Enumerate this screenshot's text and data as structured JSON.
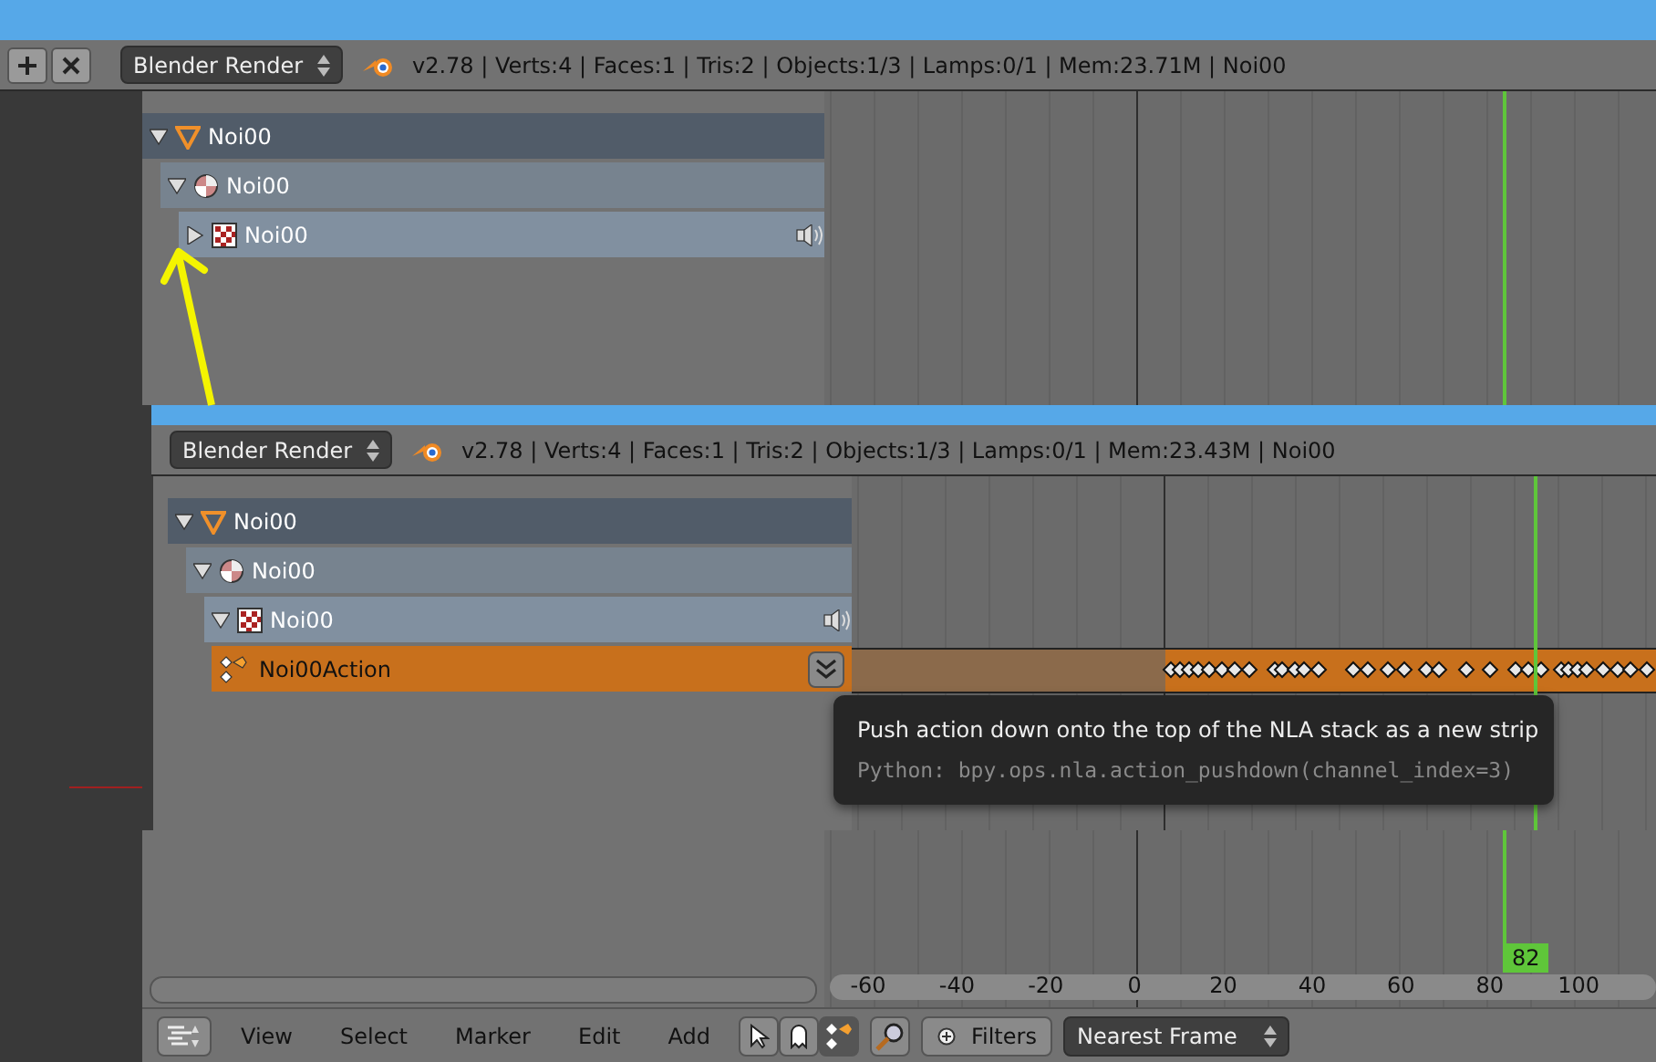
{
  "top_header": {
    "render_engine": "Blender Render",
    "stats": "v2.78 | Verts:4 | Faces:1 | Tris:2 | Objects:1/3 | Lamps:0/1 | Mem:23.71M | Noi00"
  },
  "top_channels": [
    {
      "name": "Noi00",
      "kind": "object",
      "expanded": true,
      "children": [
        {
          "name": "Noi00",
          "kind": "material",
          "expanded": true,
          "children": [
            {
              "name": "Noi00",
              "kind": "texture",
              "expanded": false
            }
          ]
        }
      ]
    }
  ],
  "bottom_header": {
    "render_engine": "Blender Render",
    "stats": "v2.78 | Verts:4 | Faces:1 | Tris:2 | Objects:1/3 | Lamps:0/1 | Mem:23.43M | Noi00"
  },
  "bottom_channels": [
    {
      "name": "Noi00",
      "kind": "object",
      "expanded": true,
      "children": [
        {
          "name": "Noi00",
          "kind": "material",
          "expanded": true,
          "children": [
            {
              "name": "Noi00",
              "kind": "texture",
              "expanded": true
            }
          ]
        }
      ]
    }
  ],
  "action_track": {
    "name": "Noi00Action"
  },
  "tooltip": {
    "title": "Push action down onto the top of the NLA stack as a new strip",
    "python": "Python: bpy.ops.nla.action_pushdown(channel_index=3)"
  },
  "current_frame": "82",
  "ruler": [
    "-60",
    "-40",
    "-20",
    "0",
    "20",
    "40",
    "60",
    "80",
    "100"
  ],
  "footer": {
    "menus": [
      "View",
      "Select",
      "Marker",
      "Edit",
      "Add"
    ],
    "filters": "Filters",
    "snap": "Nearest Frame"
  }
}
